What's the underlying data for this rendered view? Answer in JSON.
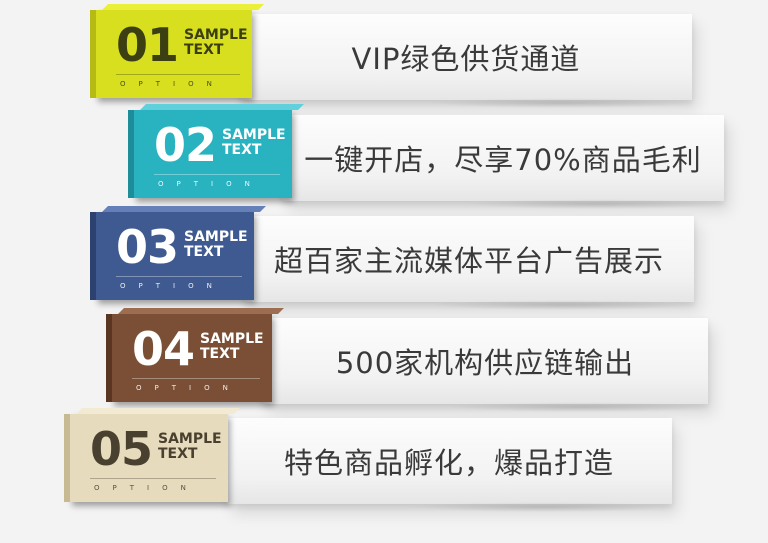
{
  "items": [
    {
      "number": "01",
      "sample_line1": "SAMPLE",
      "sample_line2": "TEXT",
      "option": "OPTION",
      "text": "VIP绿色供货通道",
      "colors": {
        "face": "#d8df1f",
        "top": "#eaf03a",
        "side": "#b5bb14",
        "ink": "#3b3f12"
      }
    },
    {
      "number": "02",
      "sample_line1": "SAMPLE",
      "sample_line2": "TEXT",
      "option": "OPTION",
      "text": "一键开店，尽享70%商品毛利",
      "colors": {
        "face": "#29b3c1",
        "top": "#5fd0dc",
        "side": "#1c8d99",
        "ink": "#ffffff"
      }
    },
    {
      "number": "03",
      "sample_line1": "SAMPLE",
      "sample_line2": "TEXT",
      "option": "OPTION",
      "text": "超百家主流媒体平台广告展示",
      "colors": {
        "face": "#3f5a90",
        "top": "#6580b8",
        "side": "#2c4170",
        "ink": "#ffffff"
      }
    },
    {
      "number": "04",
      "sample_line1": "SAMPLE",
      "sample_line2": "TEXT",
      "option": "OPTION",
      "text": "500家机构供应链输出",
      "colors": {
        "face": "#7a4f35",
        "top": "#9c6d50",
        "side": "#5a3622",
        "ink": "#ffffff"
      }
    },
    {
      "number": "05",
      "sample_line1": "SAMPLE",
      "sample_line2": "TEXT",
      "option": "OPTION",
      "text": "特色商品孵化，爆品打造",
      "colors": {
        "face": "#e7dbbd",
        "top": "#f3ead3",
        "side": "#c7b992",
        "ink": "#4a4030"
      }
    }
  ]
}
